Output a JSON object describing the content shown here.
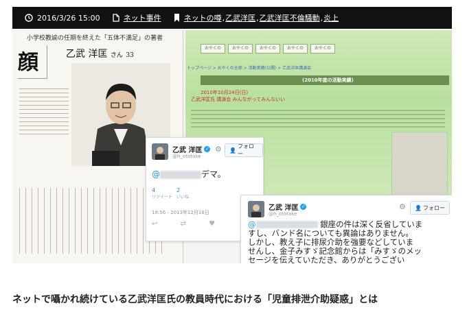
{
  "meta": {
    "date": "2016/3/26 15:00",
    "category": "ネット事件",
    "tags": [
      "ネットの噂",
      "乙武洋匡",
      "乙武洋匡不倫騒動",
      "炎上"
    ]
  },
  "newspaper": {
    "banner": "小学校教諭の任期を終えた「五体不満足」の著者",
    "name": "乙武 洋匡",
    "honorific": "さん",
    "age": "33",
    "section": "顔"
  },
  "webpage": {
    "nav_items": [
      "おやくの",
      "おやくの",
      "おやくの",
      "おやくの",
      "おやくの"
    ],
    "breadcrumb": "トップページ > おやくの全部 > 活動実績(公開) > 乙武洋匡講演会",
    "year_heading": "(2010年度の活動実績)",
    "date": "2010年10月24日(日)",
    "headline": "乙武洋匡氏 講演会 みんながってみんないい"
  },
  "tweet_1": {
    "name": "乙武 洋匡",
    "handle": "@h_ototake",
    "follow_label": "フォロー",
    "text": "デマ。",
    "retweets": "4",
    "retweets_label": "リツイート",
    "likes": "2",
    "likes_label": "いいね",
    "time": "18:56 - 2013年12月18日"
  },
  "tweet_2": {
    "name": "乙武 洋匡",
    "handle": "@h_ototake",
    "follow_label": "フォロー",
    "line1": "銀座の件は深く反省していま",
    "line2": "すし、バンド名についても異論はありません。",
    "line3": "しかし、教え子に排尿介助を強要などしていま",
    "line4": "せんし、金子みすゞ記念館からは「みすゞのメッ",
    "line5": "セージを伝えていただき、ありがとうござい"
  },
  "article_title": "ネットで囁かれ続けている乙武洋匡氏の教員時代における「児童排泄介助疑惑」とは"
}
